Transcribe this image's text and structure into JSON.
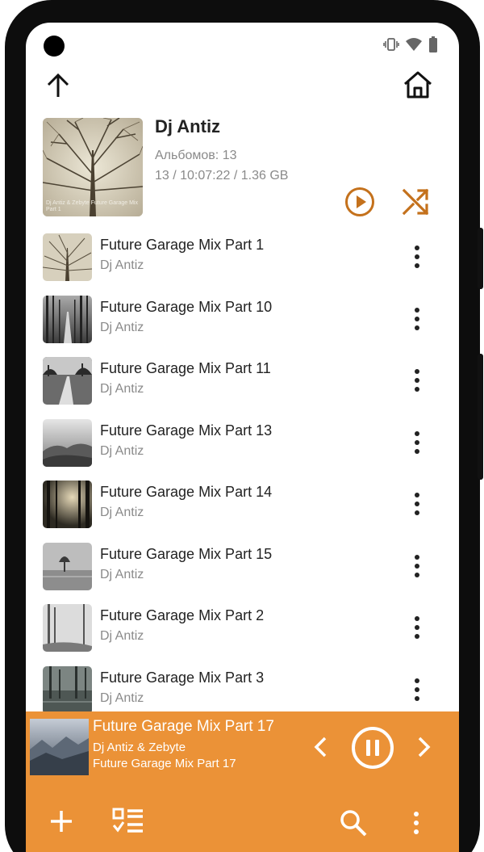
{
  "artist": {
    "name": "Dj Antiz",
    "albums": "Альбомов: 13",
    "stats": "13 / 10:07:22 / 1.36 GB",
    "cover_text": "Dj Antiz & Zebyte Future Garage Mix Part 1"
  },
  "tracks": [
    {
      "title": "Future Garage Mix Part 1",
      "artist": "Dj Antiz"
    },
    {
      "title": "Future Garage Mix Part 10",
      "artist": "Dj Antiz"
    },
    {
      "title": "Future Garage Mix Part 11",
      "artist": "Dj Antiz"
    },
    {
      "title": "Future Garage Mix Part 13",
      "artist": "Dj Antiz"
    },
    {
      "title": "Future Garage Mix Part 14",
      "artist": "Dj Antiz"
    },
    {
      "title": "Future Garage Mix Part 15",
      "artist": "Dj Antiz"
    },
    {
      "title": "Future Garage Mix Part 2",
      "artist": "Dj Antiz"
    },
    {
      "title": "Future Garage Mix Part 3",
      "artist": "Dj Antiz"
    }
  ],
  "now_playing": {
    "title": "Future Garage Mix Part 17",
    "artist": "Dj Antiz & Zebyte",
    "album": "Future Garage Mix Part 17",
    "state": "playing"
  },
  "icons": {
    "up": "arrow-up-icon",
    "home": "home-icon",
    "play": "play-circle-icon",
    "shuffle": "shuffle-icon",
    "more": "more-vertical-icon",
    "prev": "chevron-left-icon",
    "pause": "pause-circle-icon",
    "next": "chevron-right-icon",
    "add": "plus-icon",
    "queue": "checklist-icon",
    "search": "search-icon"
  },
  "colors": {
    "accent": "#eb9237",
    "accent_dark": "#c4711c",
    "text_primary": "#222222",
    "text_secondary": "#8a8a8a"
  }
}
